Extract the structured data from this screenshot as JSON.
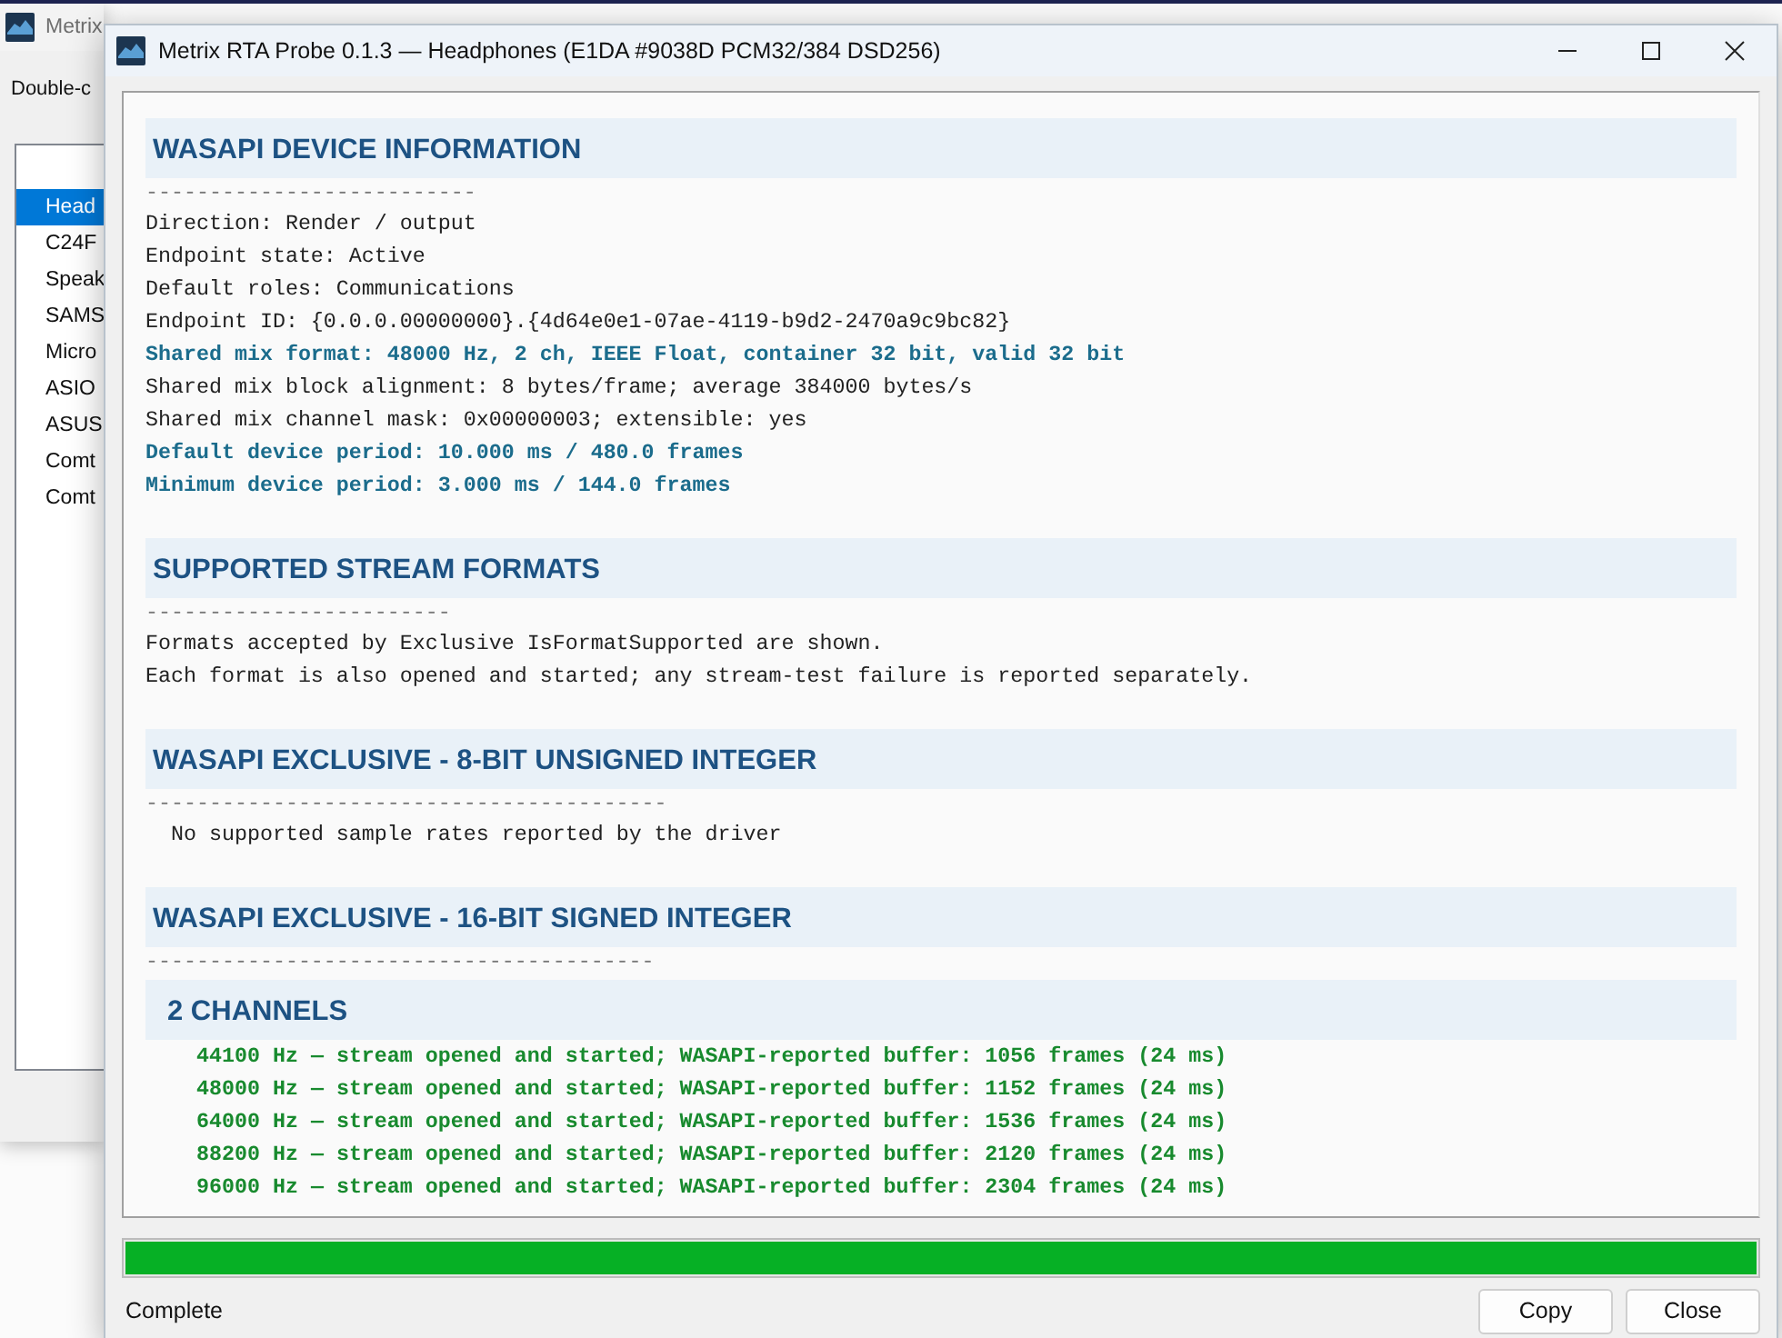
{
  "background_window": {
    "title": "Metrix",
    "prompt": "Double-c",
    "device_list": [
      {
        "label": "Head",
        "selected": true
      },
      {
        "label": "C24F",
        "selected": false
      },
      {
        "label": "Speak",
        "selected": false
      },
      {
        "label": "SAMS",
        "selected": false
      },
      {
        "label": "Micro",
        "selected": false
      },
      {
        "label": "ASIO",
        "selected": false
      },
      {
        "label": "ASUS",
        "selected": false
      },
      {
        "label": "Comt",
        "selected": false
      },
      {
        "label": "Comt",
        "selected": false
      }
    ]
  },
  "window": {
    "title": "Metrix RTA Probe 0.1.3 — Headphones (E1DA #9038D PCM32/384 DSD256)"
  },
  "report": [
    {
      "kind": "heading",
      "text": "WASAPI DEVICE INFORMATION"
    },
    {
      "kind": "rule",
      "text": "--------------------------"
    },
    {
      "kind": "line",
      "text": "Direction: Render / output"
    },
    {
      "kind": "line",
      "text": "Endpoint state: Active"
    },
    {
      "kind": "line",
      "text": "Default roles: Communications"
    },
    {
      "kind": "line",
      "text": "Endpoint ID: {0.0.0.00000000}.{4d64e0e1-07ae-4119-b9d2-2470a9c9bc82}"
    },
    {
      "kind": "info",
      "text": "Shared mix format: 48000 Hz, 2 ch, IEEE Float, container 32 bit, valid 32 bit"
    },
    {
      "kind": "line",
      "text": "Shared mix block alignment: 8 bytes/frame; average 384000 bytes/s"
    },
    {
      "kind": "line",
      "text": "Shared mix channel mask: 0x00000003; extensible: yes"
    },
    {
      "kind": "info",
      "text": "Default device period: 10.000 ms / 480.0 frames"
    },
    {
      "kind": "info",
      "text": "Minimum device period: 3.000 ms / 144.0 frames"
    },
    {
      "kind": "heading",
      "text": "SUPPORTED STREAM FORMATS"
    },
    {
      "kind": "rule",
      "text": "------------------------"
    },
    {
      "kind": "line",
      "text": "Formats accepted by Exclusive IsFormatSupported are shown."
    },
    {
      "kind": "line",
      "text": "Each format is also opened and started; any stream-test failure is reported separately."
    },
    {
      "kind": "heading",
      "text": "WASAPI EXCLUSIVE - 8-BIT UNSIGNED INTEGER"
    },
    {
      "kind": "rule",
      "text": "-----------------------------------------"
    },
    {
      "kind": "note",
      "text": "No supported sample rates reported by the driver"
    },
    {
      "kind": "heading",
      "text": "WASAPI EXCLUSIVE - 16-BIT SIGNED INTEGER"
    },
    {
      "kind": "rule",
      "text": "----------------------------------------"
    },
    {
      "kind": "subheading",
      "text": "2 CHANNELS"
    },
    {
      "kind": "ok",
      "text": "44100 Hz — stream opened and started; WASAPI-reported buffer: 1056 frames (24 ms)"
    },
    {
      "kind": "ok",
      "text": "48000 Hz — stream opened and started; WASAPI-reported buffer: 1152 frames (24 ms)"
    },
    {
      "kind": "ok",
      "text": "64000 Hz — stream opened and started; WASAPI-reported buffer: 1536 frames (24 ms)"
    },
    {
      "kind": "ok",
      "text": "88200 Hz — stream opened and started; WASAPI-reported buffer: 2120 frames (24 ms)"
    },
    {
      "kind": "ok",
      "text": "96000 Hz — stream opened and started; WASAPI-reported buffer: 2304 frames (24 ms)"
    }
  ],
  "progress": {
    "level": 1
  },
  "status": "Complete",
  "buttons": [
    "Copy",
    "Close"
  ]
}
